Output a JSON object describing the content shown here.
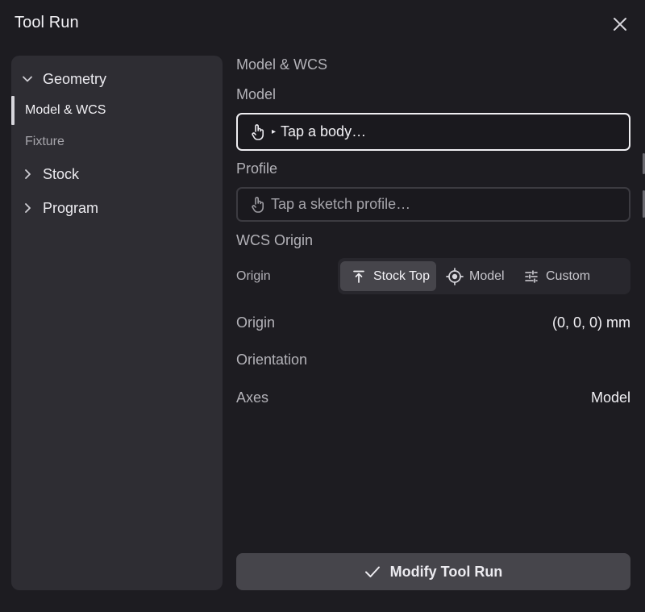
{
  "window": {
    "title": "Tool Run"
  },
  "sidebar": {
    "items": [
      {
        "label": "Geometry",
        "expanded": true
      },
      {
        "label": "Model & WCS",
        "active": true
      },
      {
        "label": "Fixture",
        "active": false
      },
      {
        "label": "Stock",
        "expanded": false
      },
      {
        "label": "Program",
        "expanded": false
      }
    ]
  },
  "main": {
    "section_title": "Model & WCS",
    "model": {
      "label": "Model",
      "placeholder": "Tap a body…"
    },
    "profile": {
      "label": "Profile",
      "placeholder": "Tap a sketch profile…"
    },
    "wcs": {
      "title": "WCS Origin",
      "origin_label": "Origin",
      "options": [
        {
          "label": "Stock Top",
          "icon": "align-top-icon",
          "selected": true
        },
        {
          "label": "Model",
          "icon": "target-icon",
          "selected": false
        },
        {
          "label": "Custom",
          "icon": "sliders-icon",
          "selected": false
        }
      ],
      "origin_value_label": "Origin",
      "origin_value": "(0, 0, 0) mm",
      "orientation_label": "Orientation",
      "axes_label": "Axes",
      "axes_value": "Model"
    },
    "primary_button": "Modify Tool Run"
  },
  "colors": {
    "background": "#1d1c21",
    "panel": "#2e2d33",
    "button": "#46454b",
    "text": "#f2f1f5",
    "muted": "#b3b2b8"
  }
}
